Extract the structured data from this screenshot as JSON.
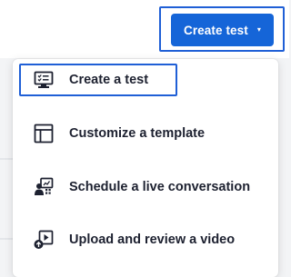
{
  "header": {
    "create_button_label": "Create test",
    "create_button_caret": "▾"
  },
  "menu": {
    "items": [
      {
        "label": "Create a test",
        "icon": "test-list-icon"
      },
      {
        "label": "Customize a template",
        "icon": "template-layout-icon"
      },
      {
        "label": "Schedule a live conversation",
        "icon": "live-conversation-icon"
      },
      {
        "label": "Upload and review a video",
        "icon": "upload-video-icon"
      }
    ]
  },
  "colors": {
    "accent": "#1565d8",
    "focus_ring": "#1f5fd6",
    "text": "#1d2130"
  }
}
